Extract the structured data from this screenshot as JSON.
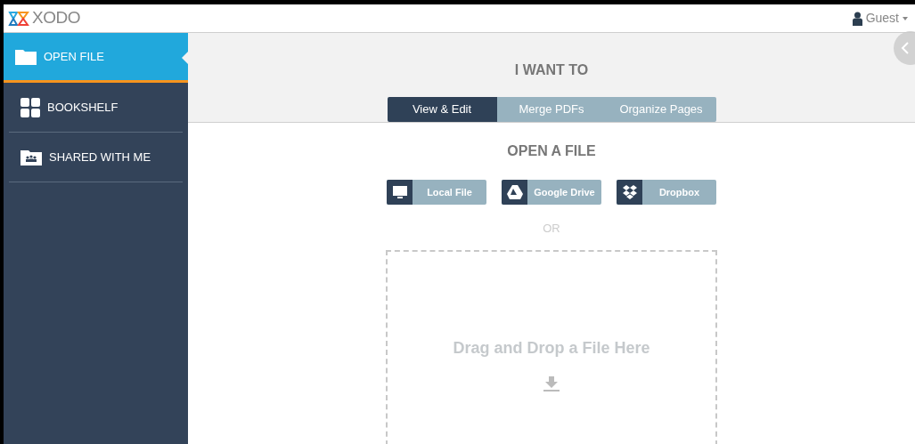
{
  "header": {
    "logo": "XODO",
    "user": "Guest"
  },
  "sidebar": {
    "items": [
      {
        "label": "OPEN FILE",
        "kind": "folder",
        "selected": true
      },
      {
        "label": "BOOKSHELF",
        "kind": "grid",
        "selected": false
      },
      {
        "label": "SHARED WITH ME",
        "kind": "shared",
        "selected": false
      }
    ]
  },
  "intent": {
    "title": "I WANT TO",
    "tabs": [
      {
        "label": "View & Edit",
        "selected": true
      },
      {
        "label": "Merge PDFs",
        "selected": false
      },
      {
        "label": "Organize Pages",
        "selected": false
      }
    ]
  },
  "open": {
    "title": "OPEN A FILE",
    "sources": [
      {
        "label": "Local File",
        "kind": "monitor"
      },
      {
        "label": "Google Drive",
        "kind": "drive"
      },
      {
        "label": "Dropbox",
        "kind": "dropbox"
      }
    ],
    "separator": "OR",
    "dropzone": "Drag and Drop a File Here"
  }
}
